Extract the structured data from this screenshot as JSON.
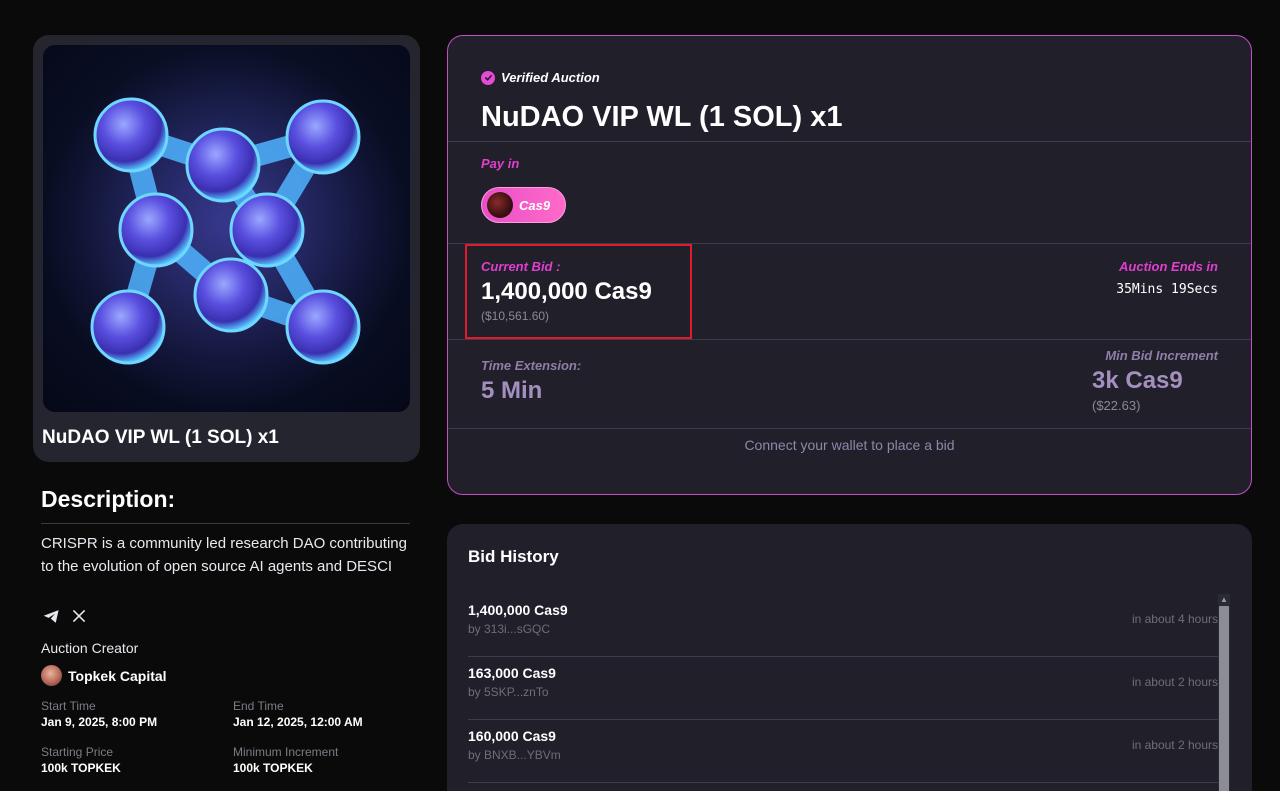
{
  "nft": {
    "title": "NuDAO VIP WL (1 SOL) x1"
  },
  "description": {
    "heading": "Description:",
    "text": "CRISPR is a community led research DAO contributing to the evolution of open source AI agents and DESCI",
    "socials": [
      "telegram-icon",
      "x-icon"
    ]
  },
  "creator": {
    "label": "Auction Creator",
    "name": "Topkek Capital"
  },
  "details": {
    "start_time_label": "Start Time",
    "start_time": "Jan 9, 2025, 8:00 PM",
    "end_time_label": "End Time",
    "end_time": "Jan 12, 2025, 12:00 AM",
    "starting_price_label": "Starting Price",
    "starting_price": "100k TOPKEK",
    "min_increment_label": "Minimum Increment",
    "min_increment": "100k TOPKEK"
  },
  "auction": {
    "verified_label": "Verified Auction",
    "title": "NuDAO VIP WL (1 SOL) x1",
    "pay_in_label": "Pay in",
    "token": "Cas9",
    "current_bid_label": "Current Bid :",
    "current_bid": "1,400,000 Cas9",
    "current_bid_usd": "($10,561.60)",
    "ends_label": "Auction Ends in",
    "ends_value": "35Mins 19Secs",
    "time_extension_label": "Time Extension:",
    "time_extension": "5 Min",
    "min_bid_increment_label": "Min Bid Increment",
    "min_bid_increment": "3k Cas9",
    "min_bid_increment_usd": "($22.63)",
    "connect_text": "Connect your wallet to place a bid"
  },
  "history": {
    "title": "Bid History",
    "bids": [
      {
        "amount": "1,400,000 Cas9",
        "by": "by 313i...sGQC",
        "time": "in about 4 hours"
      },
      {
        "amount": "163,000 Cas9",
        "by": "by 5SKP...znTo",
        "time": "in about 2 hours"
      },
      {
        "amount": "160,000 Cas9",
        "by": "by BNXB...YBVm",
        "time": "in about 2 hours"
      }
    ]
  },
  "colors": {
    "accent": "#e03fcf",
    "highlight": "#e01b2e",
    "muted_purple": "#a390bf"
  }
}
